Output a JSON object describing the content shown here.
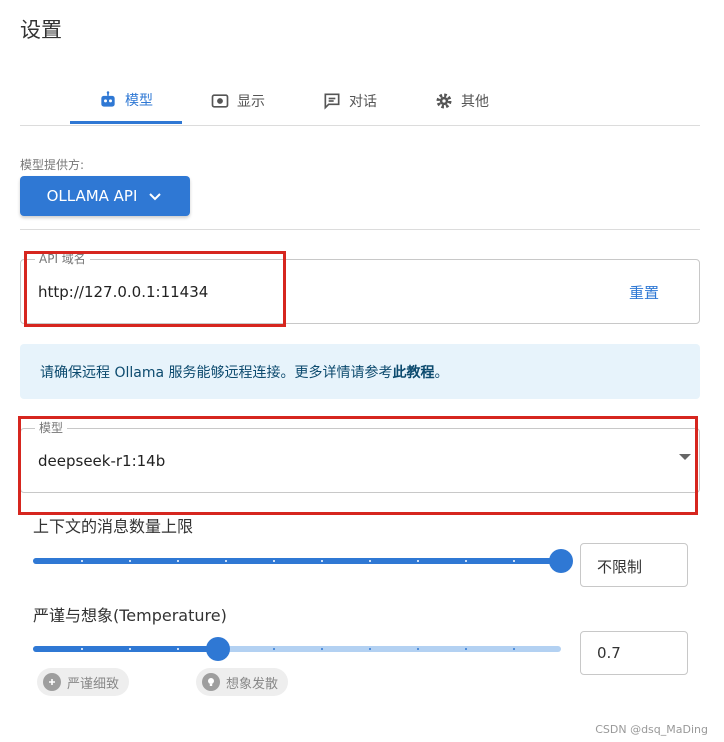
{
  "page": {
    "title": "设置"
  },
  "tabs": [
    {
      "label": "模型",
      "icon": "robot-icon",
      "active": true
    },
    {
      "label": "显示",
      "icon": "display-icon",
      "active": false
    },
    {
      "label": "对话",
      "icon": "chat-icon",
      "active": false
    },
    {
      "label": "其他",
      "icon": "gear-icon",
      "active": false
    }
  ],
  "provider": {
    "label": "模型提供方:",
    "value": "OLLAMA API"
  },
  "api_host": {
    "label": "API 域名",
    "value": "http://127.0.0.1:11434",
    "reset_label": "重置"
  },
  "info": {
    "text": "请确保远程 Ollama 服务能够远程连接。更多详情请参考",
    "link": "此教程",
    "end": "。"
  },
  "model": {
    "label": "模型",
    "value": "deepseek-r1:14b"
  },
  "context_limit": {
    "label": "上下文的消息数量上限",
    "value": "不限制",
    "fraction": 1.0
  },
  "temperature": {
    "label": "严谨与想象(Temperature)",
    "value": "0.7",
    "fraction": 0.35,
    "chip_left": "严谨细致",
    "chip_right": "想象发散"
  },
  "watermark": "CSDN @dsq_MaDing",
  "colors": {
    "accent": "#2f78d4",
    "highlight": "#d6261f",
    "info_bg": "#e7f3fb"
  }
}
